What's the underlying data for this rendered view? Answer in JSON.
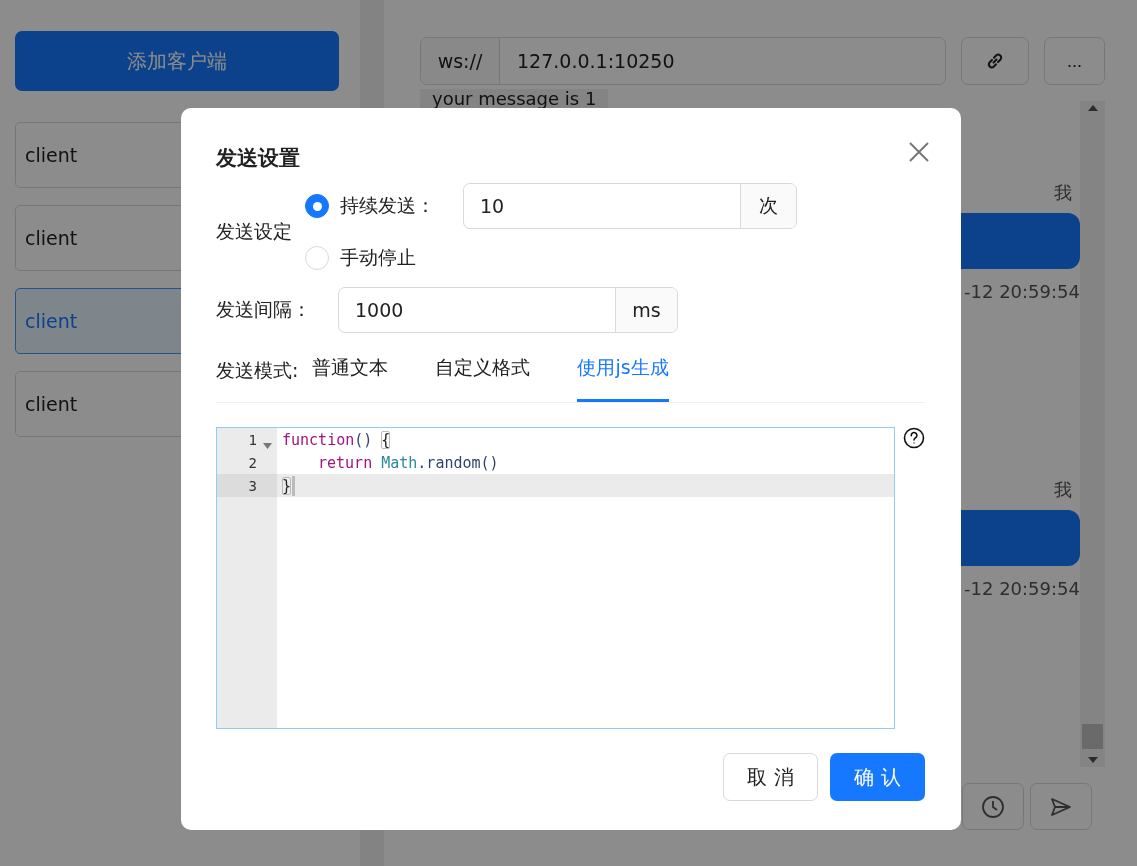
{
  "sidebar": {
    "add_button": "添加客户端",
    "clients": [
      {
        "label": "client",
        "selected": false
      },
      {
        "label": "client",
        "selected": false
      },
      {
        "label": "client",
        "selected": true
      },
      {
        "label": "client",
        "selected": false
      }
    ]
  },
  "connection": {
    "protocol": "ws://",
    "address": "127.0.0.1:10250",
    "more_button": "..."
  },
  "messages": [
    {
      "kind": "received",
      "text": "your message is 1"
    },
    {
      "kind": "sent",
      "sender": "我",
      "time": "-12 20:59:54"
    },
    {
      "kind": "sent",
      "sender": "我",
      "time": "-12 20:59:54"
    }
  ],
  "dialog": {
    "title": "发送设置",
    "send_setting": {
      "label": "发送设定",
      "options": [
        {
          "label": "持续发送：",
          "selected": true,
          "value": "10",
          "unit": "次"
        },
        {
          "label": "手动停止",
          "selected": false
        }
      ]
    },
    "interval": {
      "label": "发送间隔：",
      "value": "1000",
      "unit": "ms"
    },
    "mode": {
      "label": "发送模式:",
      "tabs": [
        {
          "label": "普通文本",
          "selected": false
        },
        {
          "label": "自定义格式",
          "selected": false
        },
        {
          "label": "使用js生成",
          "selected": true
        }
      ]
    },
    "code": {
      "lines": [
        {
          "number": "1",
          "foldable": true,
          "active": false,
          "indent": false,
          "tokens": [
            {
              "kind": "keyword",
              "text": "function"
            },
            {
              "kind": "plain",
              "text": "() "
            },
            {
              "kind": "bracket",
              "text": "{"
            }
          ]
        },
        {
          "number": "2",
          "foldable": false,
          "active": false,
          "indent": true,
          "tokens": [
            {
              "kind": "keyword",
              "text": "return"
            },
            {
              "kind": "builtin",
              "text": " Math"
            },
            {
              "kind": "plain",
              "text": ".random()"
            }
          ]
        },
        {
          "number": "3",
          "foldable": false,
          "active": true,
          "indent": false,
          "tokens": [
            {
              "kind": "bracket",
              "text": "}"
            }
          ]
        }
      ]
    },
    "cancel_button": "取 消",
    "confirm_button": "确 认"
  }
}
